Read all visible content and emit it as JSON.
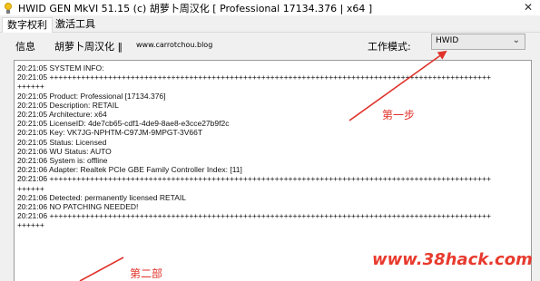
{
  "window": {
    "title": "HWID GEN MkVI 51.15 (c) 胡萝卜周汉化 [ Professional 17134.376 | x64 ]",
    "close_glyph": "✕"
  },
  "tabs": [
    {
      "label": "数字权利",
      "active": true
    },
    {
      "label": "激活工具",
      "active": false
    }
  ],
  "header": {
    "info_label": "信息",
    "credit": "胡萝卜周汉化 ‖",
    "site": "www.carrotchou.blog",
    "mode_label": "工作模式:",
    "mode_value": "HWID"
  },
  "log_lines": [
    "20:21:05 SYSTEM INFO:",
    "20:21:05 ++++++++++++++++++++++++++++++++++++++++++++++++++++++++++++++++++++++++++++++++++++++++++++++++++",
    "++++++",
    "20:21:05 Product: Professional [17134.376]",
    "20:21:05 Description: RETAIL",
    "20:21:05 Architecture: x64",
    "20:21:05 LicenseID: 4de7cb65-cdf1-4de9-8ae8-e3cce27b9f2c",
    "20:21:05 Key: VK7JG-NPHTM-C97JM-9MPGT-3V66T",
    "20:21:05 Status: Licensed",
    "20:21:06 WU Status: AUTO",
    "20:21:06 System is: offline",
    "20:21:06 Adapter: Realtek PCIe GBE Family Controller Index: [11]",
    "20:21:06 ++++++++++++++++++++++++++++++++++++++++++++++++++++++++++++++++++++++++++++++++++++++++++++++++++",
    "++++++",
    "20:21:06 Detected: permanently licensed RETAIL",
    "20:21:06 NO PATCHING NEEDED!",
    "20:21:06 ++++++++++++++++++++++++++++++++++++++++++++++++++++++++++++++++++++++++++++++++++++++++++++++++++",
    "++++++"
  ],
  "annotations": {
    "step1": "第一步",
    "step2": "第二部",
    "color": "#e0322a"
  },
  "watermark": "www.38hack.com",
  "icons": {
    "app": "lightbulb-icon",
    "dropdown": "chevron-down-icon"
  }
}
